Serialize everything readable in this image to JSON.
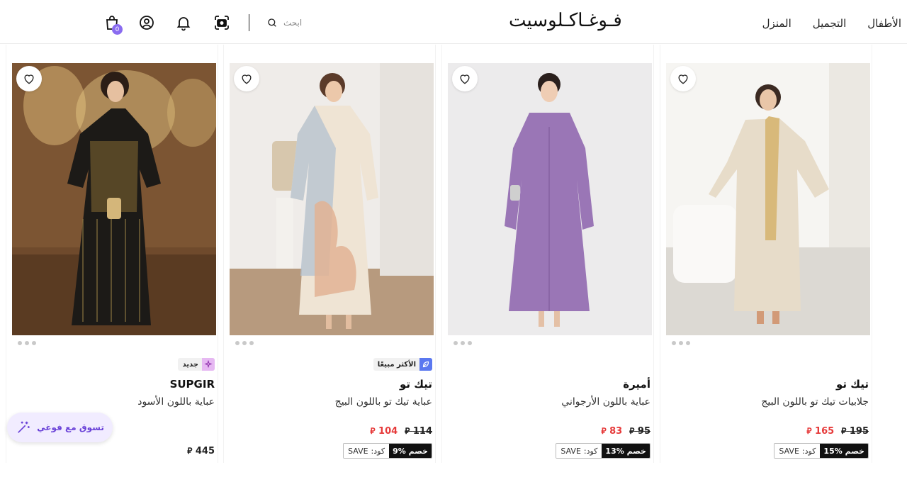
{
  "header": {
    "logo": "فـوغـاكـلوسيت",
    "nav": [
      "الأطفال",
      "التجميل",
      "المنزل"
    ],
    "search_placeholder": "ابحث",
    "cart_count": "0",
    "icons": [
      "camera-icon",
      "bell-icon",
      "user-icon",
      "shopping-bag-icon",
      "search-icon"
    ]
  },
  "currency_symbol": "⃁",
  "products": [
    {
      "brand": "تيك تو",
      "title": "جلابيات تيك تو باللون البيج",
      "old_price": "195",
      "new_price": "165",
      "discount": "15% خصم",
      "code_label": "كود:",
      "code": "SAVE"
    },
    {
      "brand": "أميرة",
      "title": "عباية باللون الأرجواني",
      "old_price": "95",
      "new_price": "83",
      "discount": "13% خصم",
      "code_label": "كود:",
      "code": "SAVE"
    },
    {
      "badge": "الأكثر مبيعًا",
      "brand": "تيك تو",
      "title": "عباية تيك تو باللون البيج",
      "old_price": "114",
      "new_price": "104",
      "discount": "9% خصم",
      "code_label": "كود:",
      "code": "SAVE"
    },
    {
      "badge": "جديد",
      "brand": "SUPGIR",
      "title": "عباية باللون الأسود",
      "price": "445"
    }
  ],
  "fab_label": "تسوق مع فوغي",
  "colors": {
    "accent": "#8a6cf0",
    "sale": "#e63a3a",
    "coupon_bg": "#111111",
    "fab_bg": "#f1ecff"
  }
}
